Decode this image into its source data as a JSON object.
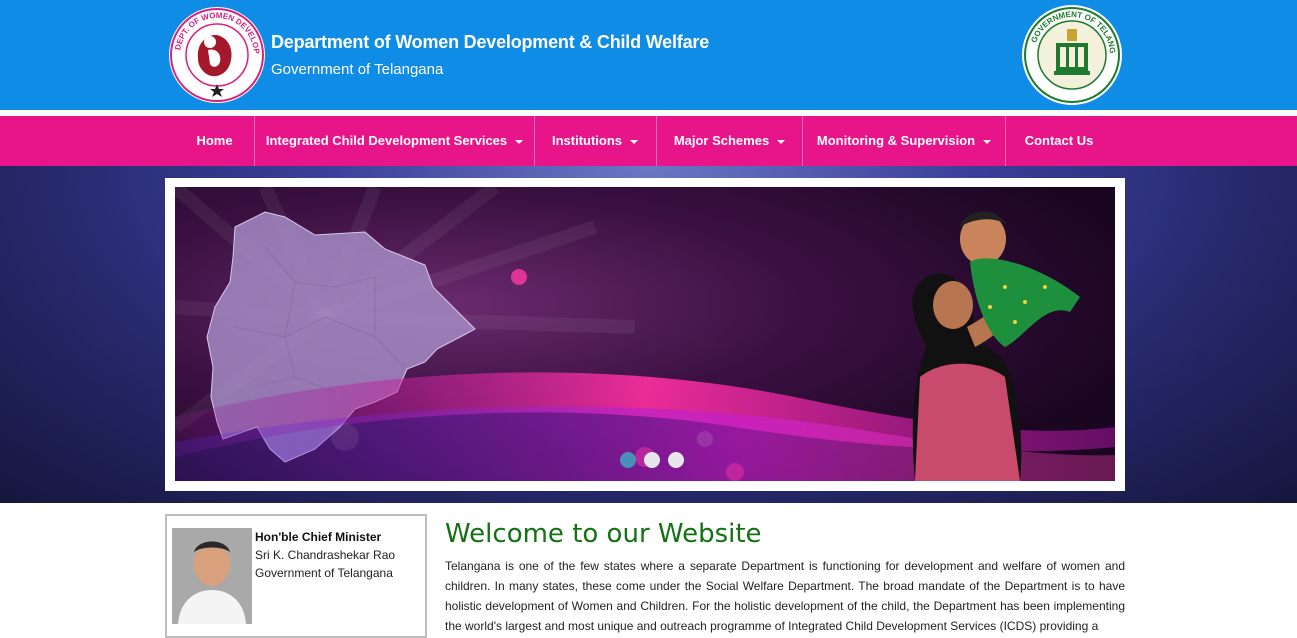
{
  "header": {
    "title": "Department of Women Development & Child Welfare",
    "subtitle": "Government of Telangana",
    "logo_text": "DEPT. OF WOMEN DEVELOPMENT & CHILD WELFARE",
    "emblem_text": "GOVERNMENT OF TELANGANA"
  },
  "nav": {
    "items": [
      {
        "label": "Home"
      },
      {
        "label": "Integrated Child Development Services"
      },
      {
        "label": "Institutions"
      },
      {
        "label": "Major Schemes"
      },
      {
        "label": "Monitoring & Supervision"
      },
      {
        "label": "Contact Us"
      }
    ]
  },
  "slider": {
    "dots": [
      {
        "active": true
      },
      {
        "active": false
      },
      {
        "active": false
      }
    ]
  },
  "cm": {
    "title": "Hon'ble Chief Minister",
    "name": "Sri K. Chandrashekar Rao",
    "org": "Government of Telangana"
  },
  "welcome": {
    "heading": "Welcome to our Website",
    "text": "Telangana is one of the few states where a separate Department is functioning for development and welfare of women and children. In many states, these come under the Social Welfare Department. The broad mandate of the Department is to have holistic development of Women and Children. For the holistic development of the child, the Department has been implementing the world's largest and most unique and outreach programme of Integrated Child Development Services (ICDS) providing a"
  },
  "colors": {
    "header_blue": "#0f8de6",
    "nav_pink": "#e8158a",
    "welcome_green": "#127212"
  }
}
